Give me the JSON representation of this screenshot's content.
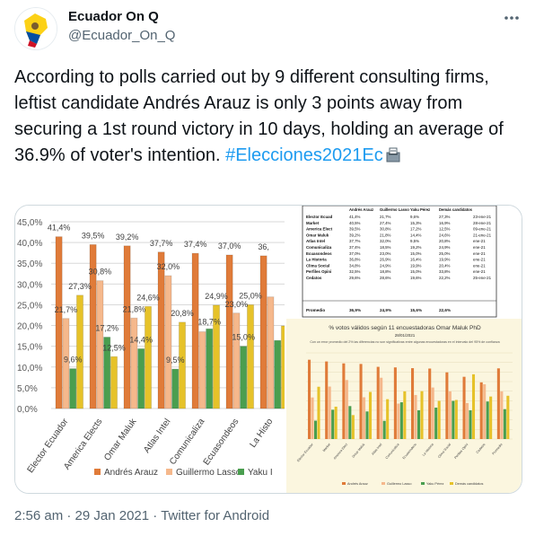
{
  "tweet": {
    "display_name": "Ecuador On Q",
    "handle": "@Ecuador_On_Q",
    "more_icon": "more-dots-icon",
    "text": "According to polls carried out by 9 different consulting firms, leftist candidate Andrés Arauz is only 3 points away from securing a 1st round victory in 10 days, holding an average of 36.9% of voter's intention. ",
    "hashtag": "#Elecciones2021Ec",
    "emoji_icon": "ballot-box-icon",
    "time": "2:56 am",
    "sep": " · ",
    "date": "29 Jan 2021",
    "source": "Twitter for Android"
  },
  "colors": {
    "arauz": "#e07b39",
    "lasso": "#f5b88c",
    "perez": "#4a9e4f",
    "others": "#e6c229",
    "accent": "#1d9bf0"
  },
  "chart_data": [
    {
      "type": "bar",
      "categories": [
        "Elector Ecuador",
        "America Elects",
        "Omar Maluk",
        "Atlas Intel",
        "Comunicaliza",
        "Ecuasondeos",
        "La Histo"
      ],
      "series": [
        {
          "name": "Andrés Arauz",
          "values": [
            41.4,
            39.5,
            39.2,
            37.7,
            37.4,
            37.0,
            36.8
          ]
        },
        {
          "name": "Guillermo Lasso",
          "values": [
            21.7,
            30.8,
            21.8,
            32.0,
            18.5,
            23.0,
            26.9
          ]
        },
        {
          "name": "Yaku I",
          "values": [
            9.6,
            17.2,
            14.4,
            9.5,
            19.2,
            15.0,
            16.4
          ]
        },
        {
          "name": "",
          "values": [
            27.3,
            12.5,
            24.6,
            20.8,
            24.9,
            25.0,
            19.9
          ]
        }
      ],
      "data_labels": [
        "41,4%",
        "39,5%",
        "39,2%",
        "37,7%",
        "37,4%",
        "37,0%",
        "36,",
        "21,7%",
        "30,8%",
        "21,8%",
        "32,0%",
        "20,8%",
        "18,7%",
        "23,0%",
        "9,6%",
        "17,2%",
        "12,5%",
        "14,4%",
        "9,5%",
        "24,9%",
        "15,0%",
        "27,3%",
        "24,6%",
        "25,0%"
      ],
      "ytick_labels": [
        "45,0%",
        "40,0%",
        "35,0%",
        "30,0%",
        "25,0%",
        "20,0%",
        "15,0%",
        "10,0%",
        "5,0%",
        "0,0%"
      ],
      "ylim": [
        0,
        45
      ],
      "grid": true,
      "legend": "bottom"
    },
    {
      "type": "table",
      "columns": [
        "",
        "Andrés Arauz",
        "Guillermo Lasso",
        "Yaku Pérez",
        "Demás candidatos",
        ""
      ],
      "rows": [
        [
          "Elector Ecuad",
          "41,4%",
          "21,7%",
          "9,6%",
          "27,3%",
          "23-ene-21"
        ],
        [
          "Market",
          "40,5%",
          "27,4%",
          "15,3%",
          "16,9%",
          "28-ene-21"
        ],
        [
          "America Elect",
          "39,5%",
          "30,8%",
          "17,2%",
          "12,5%",
          "09-ene-21"
        ],
        [
          "Omar Maluk",
          "39,2%",
          "21,8%",
          "14,4%",
          "24,6%",
          "21-ene-21"
        ],
        [
          "Atlas Intel",
          "37,7%",
          "32,0%",
          "9,5%",
          "20,8%",
          "ene-21"
        ],
        [
          "Comunicaliza",
          "37,4%",
          "18,5%",
          "19,2%",
          "24,9%",
          "ene-21"
        ],
        [
          "Ecuasondeos",
          "37,0%",
          "23,0%",
          "15,0%",
          "25,0%",
          "ene-21"
        ],
        [
          "La Historia",
          "36,8%",
          "26,9%",
          "16,4%",
          "19,9%",
          "ene-21"
        ],
        [
          "Clima Social",
          "34,8%",
          "24,9%",
          "19,9%",
          "20,4%",
          "ene-21"
        ],
        [
          "Perfiles Opini",
          "32,5%",
          "18,8%",
          "15,0%",
          "33,8%",
          "ene-21"
        ],
        [
          "Cedatos",
          "29,6%",
          "28,6%",
          "19,6%",
          "22,2%",
          "25-ene-21"
        ]
      ],
      "summary_row": [
        "Promedio",
        "36,9%",
        "24,9%",
        "15,6%",
        "22,6%"
      ]
    },
    {
      "type": "bar",
      "title": "% votos válidos según 11 encuestadoras",
      "author": "Omar Maluk PhD",
      "date": "28/01/2021",
      "subtitle": "Con un error promedio del 2% las diferencias no son significativas entre algunas encuestadoras en el intervalo del 95% de confianza",
      "categories": [
        "Elector Ecuador",
        "Market",
        "America Elect",
        "Omar Maluk",
        "Atlas Intel",
        "Comunicaliza",
        "Ecuasondeos",
        "La Historia",
        "Clima Social",
        "Perfiles Opini",
        "Cedatos",
        "Promedio"
      ],
      "series": [
        {
          "name": "Andrés Arauz",
          "values": [
            41.4,
            40.5,
            39.5,
            39.2,
            37.7,
            37.4,
            37.0,
            36.8,
            34.8,
            32.5,
            29.6,
            36.9
          ]
        },
        {
          "name": "Guillermo Lasso",
          "values": [
            21.7,
            27.4,
            30.8,
            21.8,
            32.0,
            18.5,
            23.0,
            26.9,
            24.9,
            18.8,
            28.6,
            24.9
          ]
        },
        {
          "name": "Yaku Pérez",
          "values": [
            9.6,
            15.3,
            17.2,
            14.4,
            9.5,
            19.2,
            15.0,
            16.4,
            19.9,
            15.0,
            19.6,
            15.6
          ]
        },
        {
          "name": "Demás candidatos",
          "values": [
            27.3,
            16.9,
            12.5,
            24.6,
            20.8,
            24.9,
            25.0,
            19.9,
            20.4,
            33.8,
            22.2,
            22.6
          ]
        }
      ],
      "legend": "bottom"
    }
  ]
}
